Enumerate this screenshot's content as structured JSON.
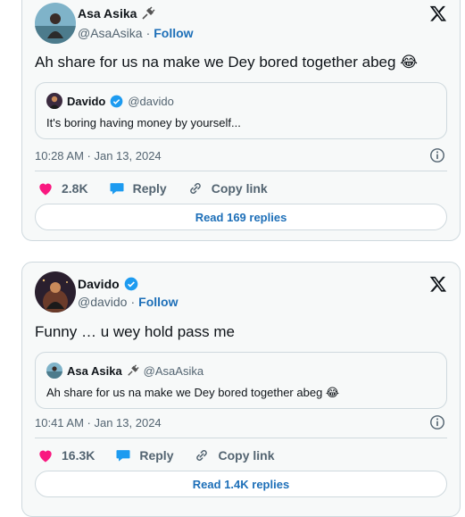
{
  "tweets": [
    {
      "author_name": "Asa Asika",
      "author_handle": "@AsaAsika",
      "separator": "·",
      "follow_label": "Follow",
      "text": "Ah share for us na make we Dey bored together abeg 😂",
      "quote": {
        "author_name": "Davido",
        "author_handle": "@davido",
        "text": "It's boring having money by yourself..."
      },
      "timestamp": "10:28 AM · Jan 13, 2024",
      "likes": "2.8K",
      "reply_label": "Reply",
      "copy_label": "Copy link",
      "read_replies_label": "Read 169 replies"
    },
    {
      "author_name": "Davido",
      "author_handle": "@davido",
      "separator": "·",
      "follow_label": "Follow",
      "text": "Funny … u wey hold pass me",
      "quote": {
        "author_name": "Asa Asika",
        "author_handle": "@AsaAsika",
        "text": "Ah share for us na make we Dey bored together abeg 😂"
      },
      "timestamp": "10:41 AM · Jan 13, 2024",
      "likes": "16.3K",
      "reply_label": "Reply",
      "copy_label": "Copy link",
      "read_replies_label": "Read 1.4K replies"
    }
  ],
  "icons": {
    "like": "heart-icon",
    "reply": "speech-bubble-icon",
    "copy": "link-icon",
    "info": "info-icon",
    "brand": "x-logo-icon",
    "verified": "verified-badge-icon",
    "plug": "plug-icon"
  },
  "colors": {
    "like": "#f91880",
    "reply": "#1d9bf0",
    "link_blue": "#1d6fb8",
    "verified": "#1d9bf0",
    "muted": "#536471",
    "border": "#cfd9de",
    "card_bg": "#f7f9f9"
  }
}
